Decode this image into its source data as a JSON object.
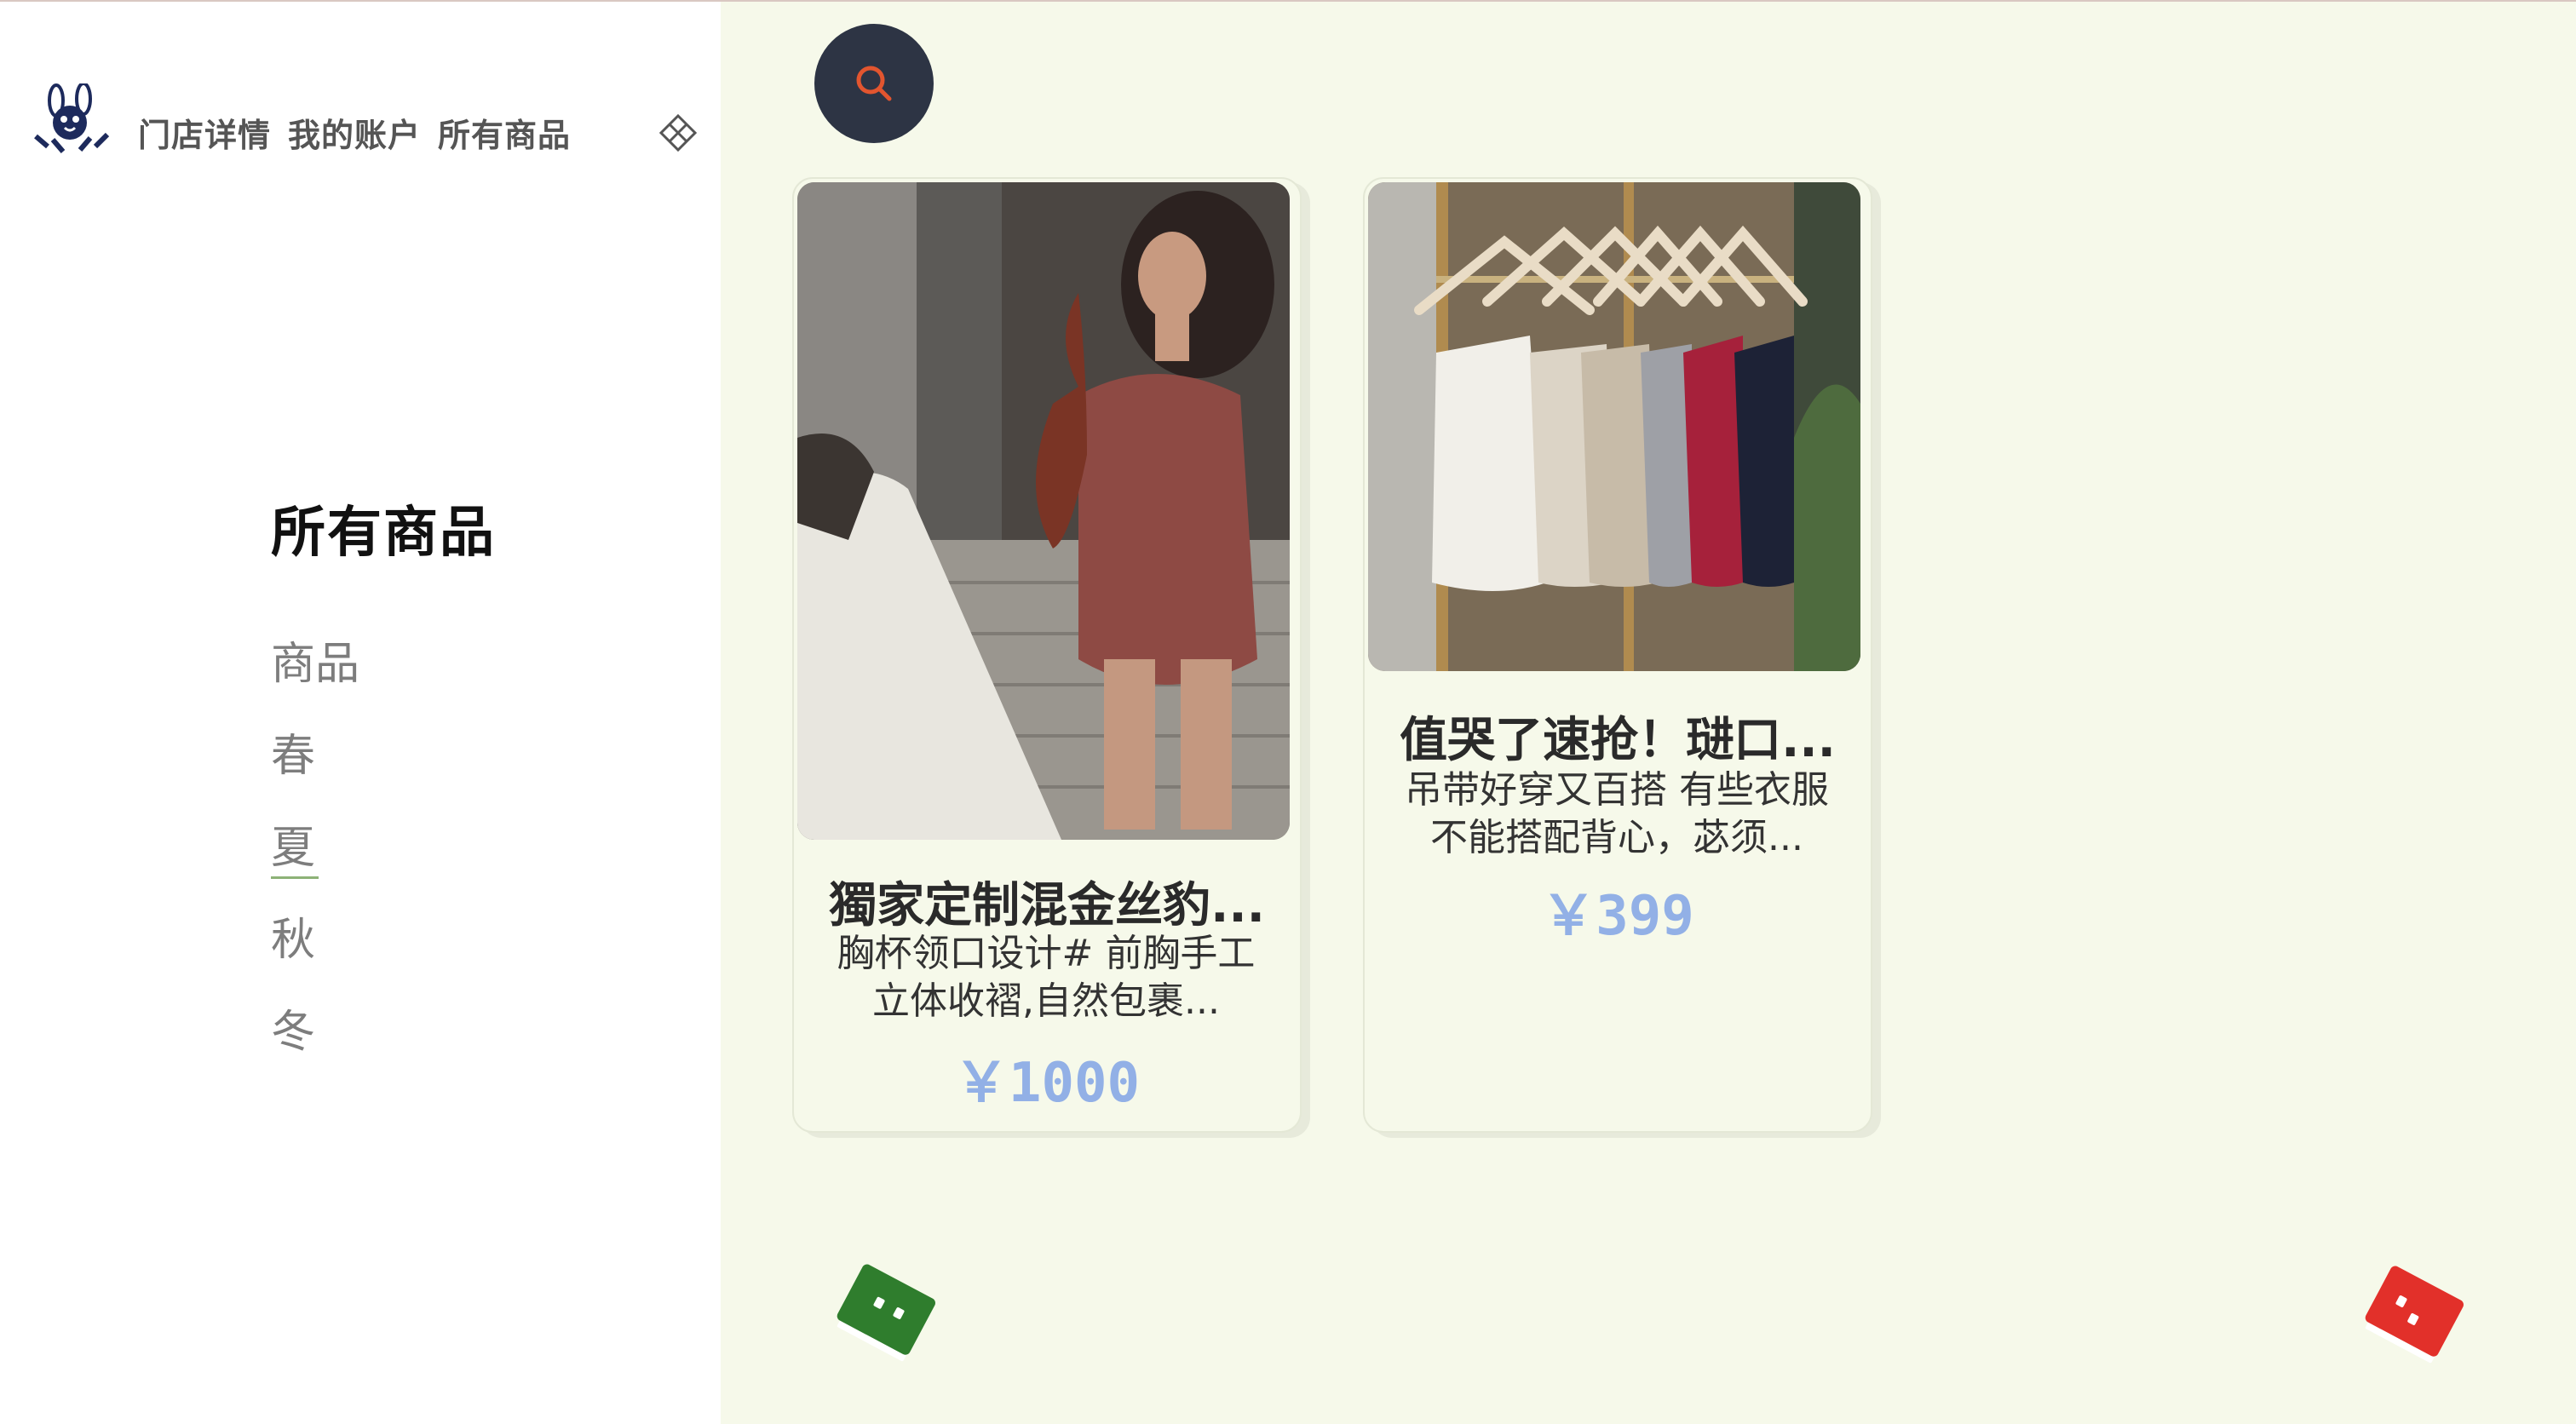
{
  "nav": {
    "items": [
      "门店详情",
      "我的账户",
      "所有商品"
    ]
  },
  "sidebar": {
    "title": "所有商品",
    "categories": [
      {
        "label": "商品",
        "active": false
      },
      {
        "label": "春",
        "active": false
      },
      {
        "label": "夏",
        "active": true
      },
      {
        "label": "秋",
        "active": false
      },
      {
        "label": "冬",
        "active": false
      }
    ]
  },
  "products": [
    {
      "name": "獨家定制混金丝豹...",
      "description": "胸杯领口设计# 前胸手工立体收褶,自然包裹...",
      "price": "￥1000"
    },
    {
      "name": "值哭了速抢！琎口...",
      "description": "吊带好穿又百搭 有些衣服不能搭配背心，苾须...",
      "price": "￥399"
    }
  ],
  "colors": {
    "accent_price": "#92b0e6",
    "search_button": "#2d3444",
    "search_icon": "#e2552f",
    "active_underline": "#8db277",
    "note_green": "#2f7d2d",
    "note_red": "#e2302a"
  },
  "icons": [
    "brand-logo",
    "nav-toggle-icon",
    "search-icon",
    "green-note-icon",
    "red-note-icon"
  ]
}
